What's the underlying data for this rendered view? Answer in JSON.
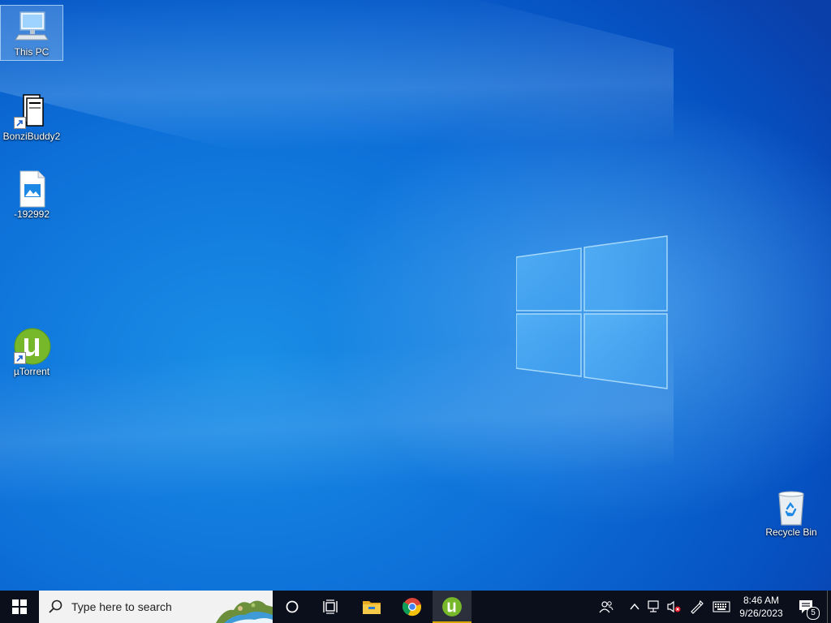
{
  "desktop": {
    "icons": [
      {
        "label": "This PC",
        "icon": "computer-icon"
      },
      {
        "label": "BonziBuddy2",
        "icon": "folder-shortcut-icon"
      },
      {
        "label": "-192992",
        "icon": "image-file-icon"
      },
      {
        "label": "µTorrent",
        "icon": "utorrent-icon"
      },
      {
        "label": "Recycle Bin",
        "icon": "recycle-bin-icon"
      }
    ]
  },
  "taskbar": {
    "search_placeholder": "Type here to search",
    "pinned": [
      "cortana-icon",
      "task-view-icon",
      "file-explorer-icon",
      "chrome-icon",
      "utorrent-icon"
    ],
    "tray": {
      "time": "8:46 AM",
      "date": "9/26/2023",
      "notification_count": "5"
    }
  },
  "colors": {
    "wallpaper": "#0d6fd8",
    "taskbar": "#0b0f1c",
    "utorrent_green": "#76b82a",
    "active_indicator": "#d9a800"
  }
}
